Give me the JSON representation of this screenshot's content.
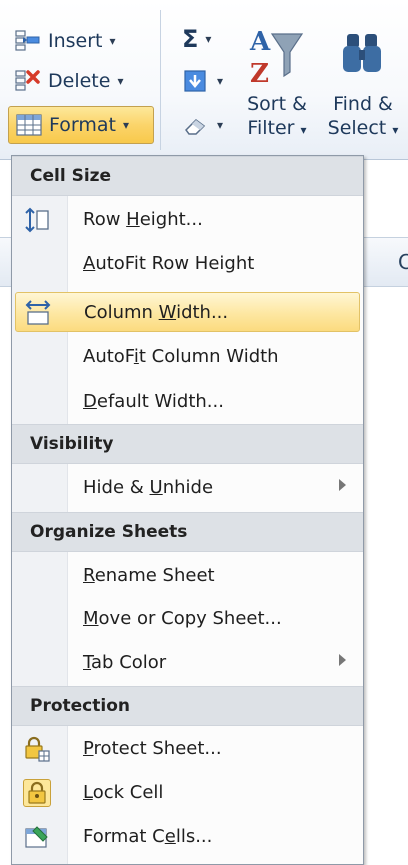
{
  "ribbon": {
    "insert_label": "Insert",
    "delete_label": "Delete",
    "format_label": "Format",
    "sum_symbol": "Σ",
    "sort_filter_line1": "Sort &",
    "sort_filter_line2": "Filter",
    "find_select_line1": "Find &",
    "find_select_line2": "Select",
    "caret": "▾"
  },
  "sheet": {
    "column_c": "C"
  },
  "menu": {
    "sections": {
      "cell_size": "Cell Size",
      "visibility": "Visibility",
      "organize_sheets": "Organize Sheets",
      "protection": "Protection"
    },
    "items": {
      "row_height": {
        "pre": "Row ",
        "u": "H",
        "post": "eight..."
      },
      "autofit_row": {
        "pre": "",
        "u": "A",
        "post": "utoFit Row Height"
      },
      "column_width": {
        "pre": "Column ",
        "u": "W",
        "post": "idth..."
      },
      "autofit_column": {
        "pre": "AutoF",
        "u": "i",
        "post": "t Column Width"
      },
      "default_width": {
        "pre": "",
        "u": "D",
        "post": "efault Width..."
      },
      "hide_unhide": {
        "pre": "Hide & ",
        "u": "U",
        "post": "nhide"
      },
      "rename_sheet": {
        "pre": "",
        "u": "R",
        "post": "ename Sheet"
      },
      "move_copy": {
        "pre": "",
        "u": "M",
        "post": "ove or Copy Sheet..."
      },
      "tab_color": {
        "pre": "",
        "u": "T",
        "post": "ab Color"
      },
      "protect_sheet": {
        "pre": "",
        "u": "P",
        "post": "rotect Sheet..."
      },
      "lock_cell": {
        "pre": "",
        "u": "L",
        "post": "ock Cell"
      },
      "format_cells": {
        "pre": "Format C",
        "u": "e",
        "post": "lls..."
      }
    }
  }
}
